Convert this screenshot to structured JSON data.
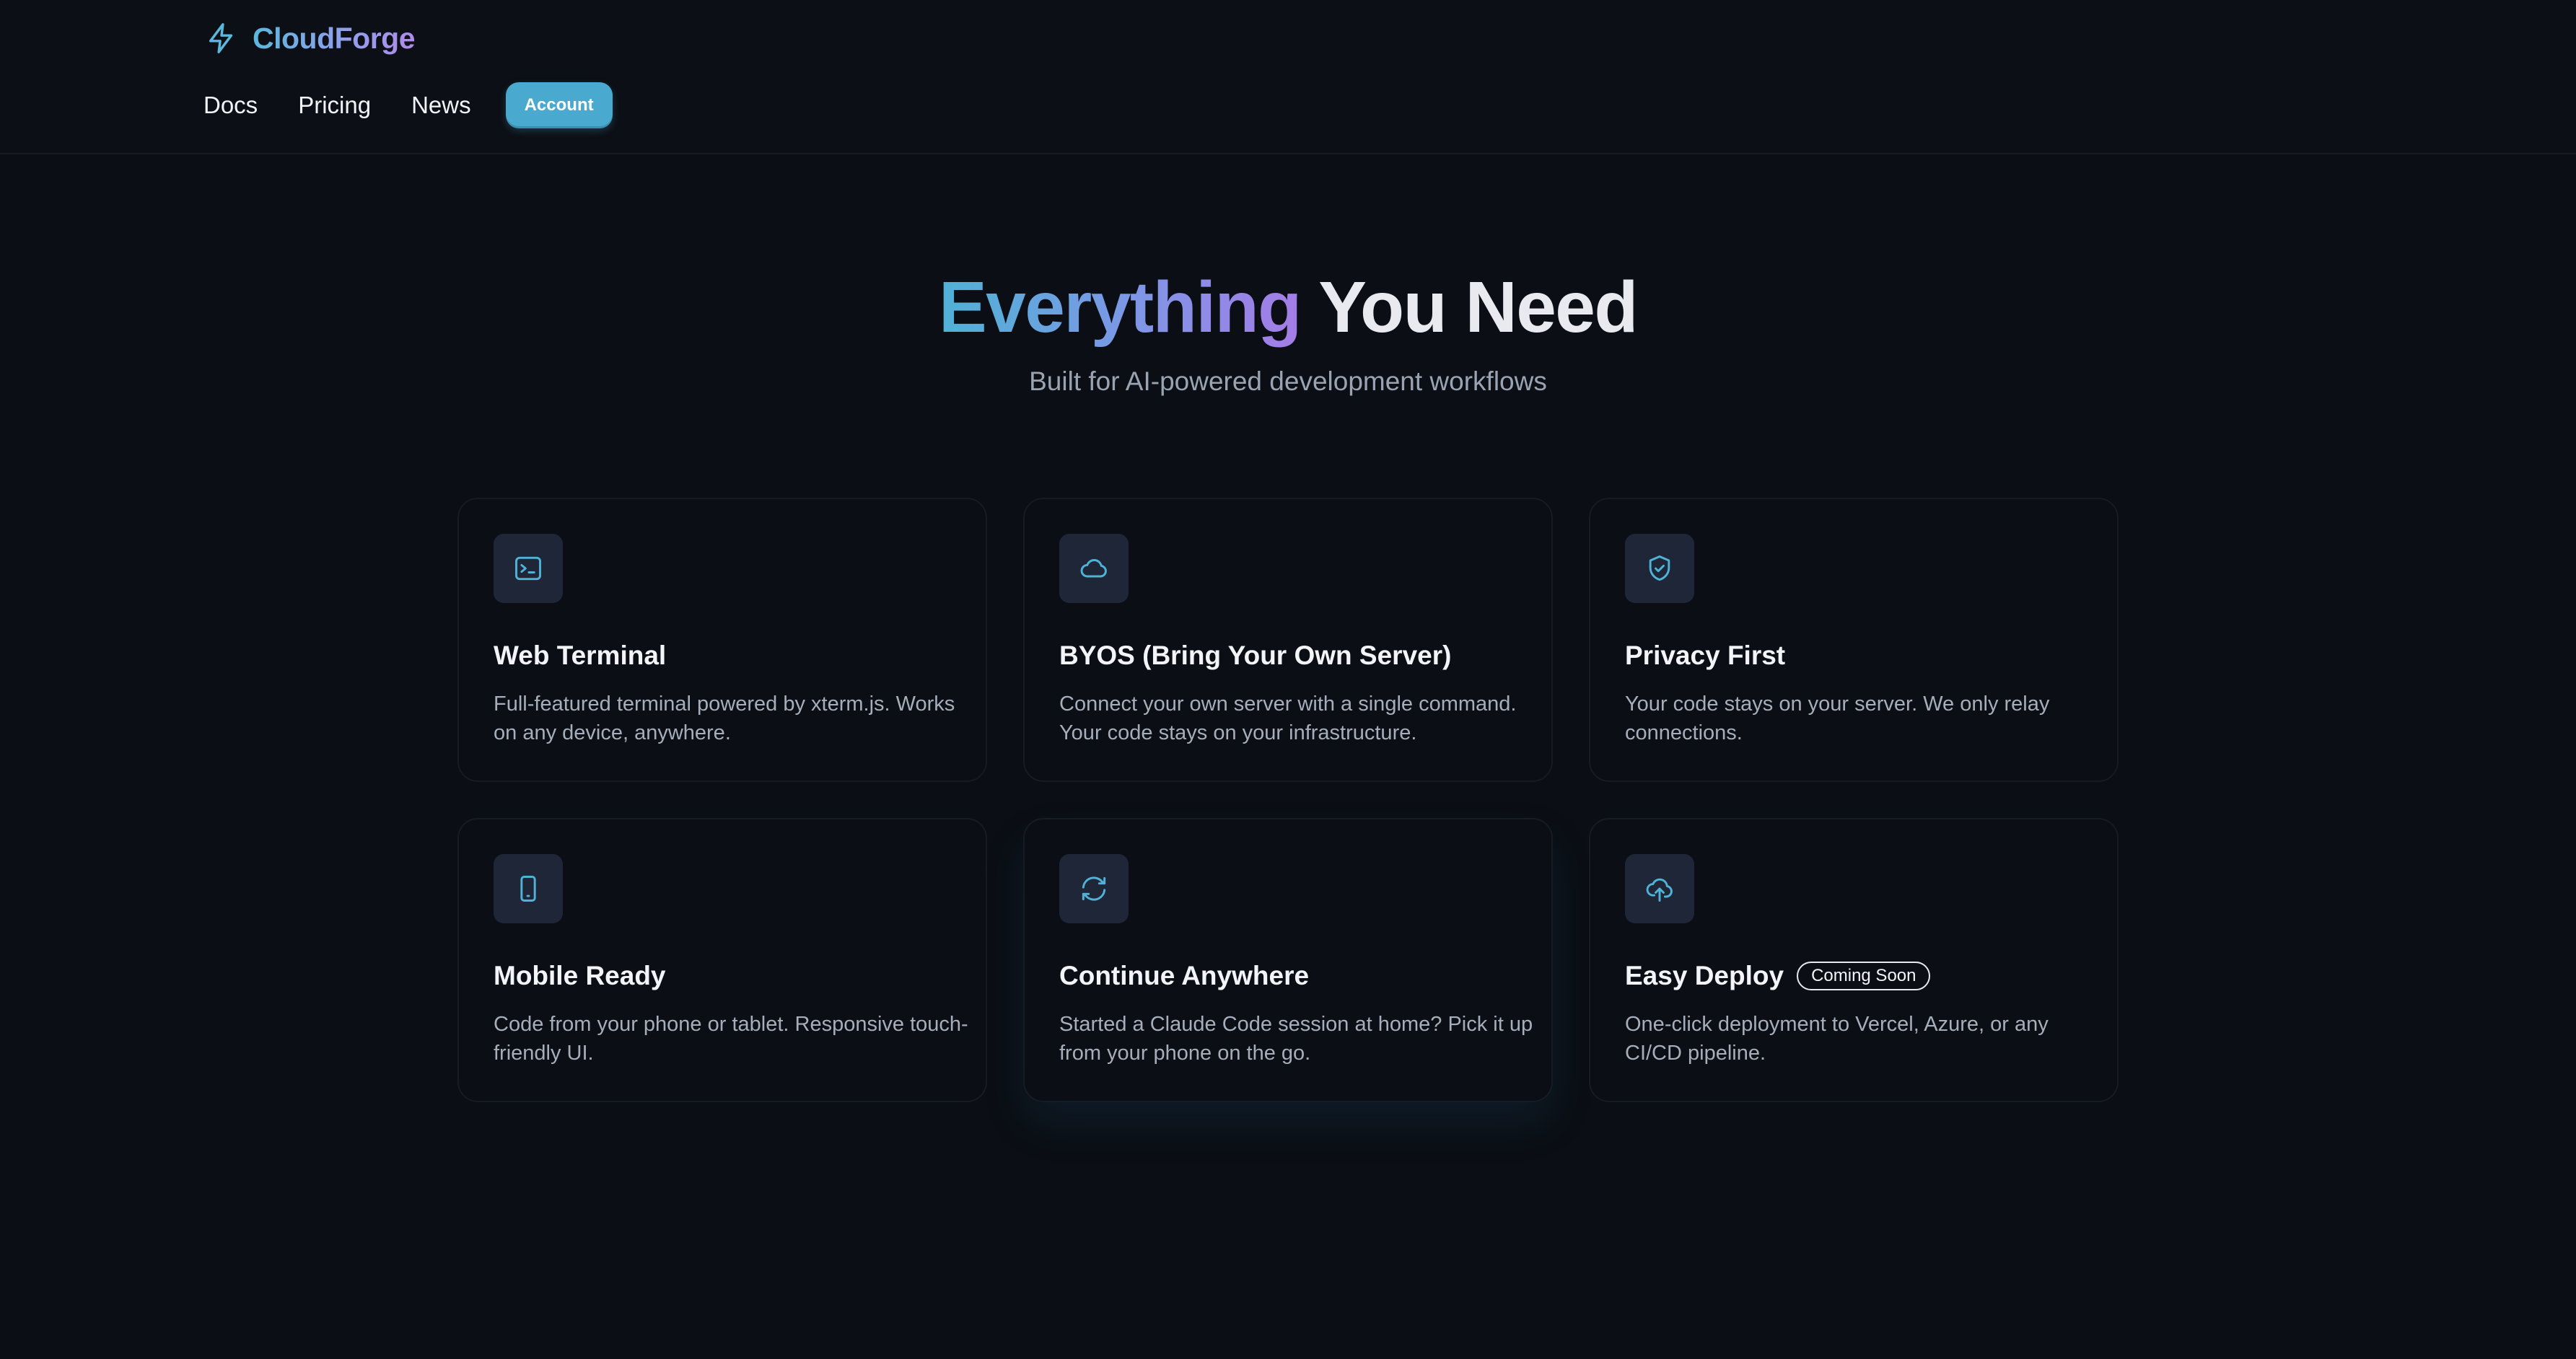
{
  "brand": {
    "name": "CloudForge",
    "icon": "bolt-icon"
  },
  "nav": {
    "links": [
      "Docs",
      "Pricing",
      "News"
    ],
    "account_label": "Account"
  },
  "hero": {
    "title_highlight": "Everything",
    "title_rest": "You Need",
    "subtitle": "Built for AI-powered development workflows"
  },
  "features": [
    {
      "icon": "terminal-icon",
      "title": "Web Terminal",
      "description": "Full-featured terminal powered by xterm.js. Works on any device, anywhere.",
      "badge": ""
    },
    {
      "icon": "cloud-icon",
      "title": "BYOS (Bring Your Own Server)",
      "description": "Connect your own server with a single command. Your code stays on your infrastructure.",
      "badge": ""
    },
    {
      "icon": "shield-check-icon",
      "title": "Privacy First",
      "description": "Your code stays on your server. We only relay connections.",
      "badge": ""
    },
    {
      "icon": "smartphone-icon",
      "title": "Mobile Ready",
      "description": "Code from your phone or tablet. Responsive touch-friendly UI.",
      "badge": ""
    },
    {
      "icon": "refresh-icon",
      "title": "Continue Anywhere",
      "description": "Started a Claude Code session at home? Pick it up from your phone on the go.",
      "badge": ""
    },
    {
      "icon": "cloud-upload-icon",
      "title": "Easy Deploy",
      "description": "One-click deployment to Vercel, Azure, or any CI/CD pipeline.",
      "badge": "Coming Soon"
    }
  ],
  "colors": {
    "background": "#0b0e14",
    "accent": "#49a9ce",
    "icon_tile": "#1e2638",
    "gradient_start": "#4fb2d6",
    "gradient_end": "#a47ce6"
  }
}
